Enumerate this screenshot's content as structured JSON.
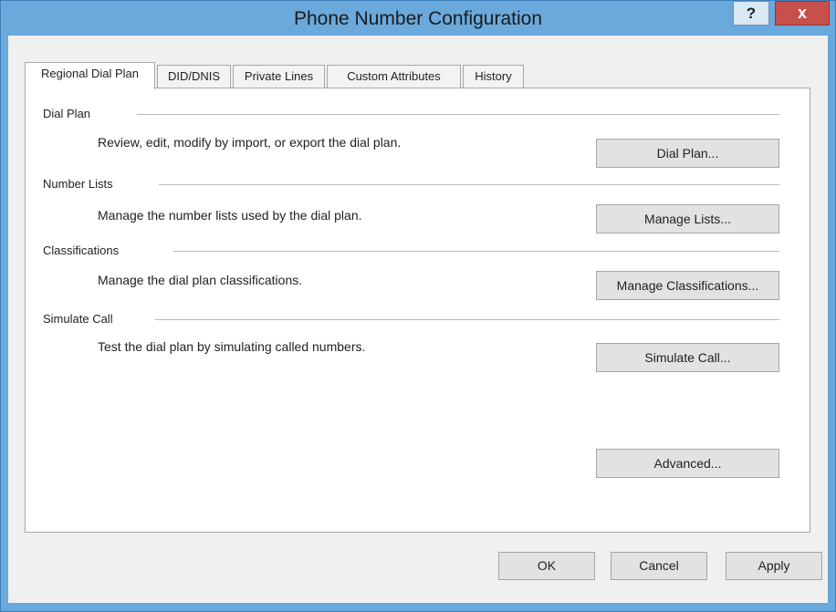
{
  "window": {
    "title": "Phone Number Configuration",
    "help_label": "?",
    "close_label": "x"
  },
  "tabs": [
    {
      "label": "Regional Dial Plan",
      "active": true
    },
    {
      "label": "DID/DNIS",
      "active": false
    },
    {
      "label": "Private Lines",
      "active": false
    },
    {
      "label": "Custom Attributes",
      "active": false
    },
    {
      "label": "History",
      "active": false
    }
  ],
  "sections": [
    {
      "label": "Dial Plan",
      "description": "Review, edit, modify by import, or export the dial plan.",
      "button": "Dial Plan..."
    },
    {
      "label": "Number Lists",
      "description": "Manage the number lists used by the dial plan.",
      "button": "Manage Lists..."
    },
    {
      "label": "Classifications",
      "description": "Manage the dial plan classifications.",
      "button": "Manage Classifications..."
    },
    {
      "label": "Simulate Call",
      "description": "Test the dial plan by simulating called numbers.",
      "button": "Simulate Call..."
    }
  ],
  "advanced_button": "Advanced...",
  "footer": {
    "ok": "OK",
    "cancel": "Cancel",
    "apply": "Apply"
  }
}
